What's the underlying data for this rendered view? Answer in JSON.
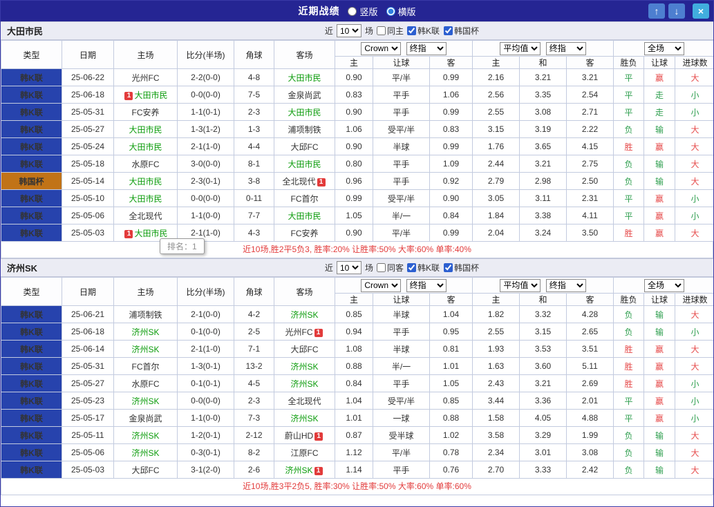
{
  "titlebar": {
    "title": "近期战绩",
    "layout_options": [
      "竖版",
      "横版"
    ],
    "selected_layout": "横版"
  },
  "tooltip": {
    "text": "排名：1"
  },
  "filters_template": {
    "prefix": "近",
    "count": "10",
    "suffix": "场"
  },
  "header_template": {
    "main_cols": [
      "类型",
      "日期",
      "主场",
      "比分(半场)",
      "角球",
      "客场"
    ],
    "odds_group": {
      "bookmaker": "Crown",
      "index": "终指",
      "subcols": [
        "主",
        "让球",
        "客"
      ]
    },
    "europe_group": {
      "average": "平均值",
      "index": "终指",
      "subcols": [
        "主",
        "和",
        "客"
      ]
    },
    "result_group": {
      "scope": "全场",
      "subcols": [
        "胜负",
        "让球",
        "进球数"
      ]
    }
  },
  "league_styles": {
    "韩K联": "k",
    "韩国杯": "cup"
  },
  "value_colors": {
    "胜": "#e64a4a",
    "平": "#2e9e4e",
    "负": "#2e9e4e",
    "赢": "#e64a4a",
    "输": "#2e9e4e",
    "走": "#2e9e4e",
    "大": "#e64a4a",
    "小": "#2e9e4e"
  },
  "colors": {
    "titlebar_bg": "#252593",
    "league_blue": "#2743ad",
    "cup_orange": "#c17317",
    "focal_team_green": "#0a9b0a",
    "score_red": "#c8382b",
    "summary_red": "#e23a3a"
  },
  "sections": [
    {
      "team": "大田市民",
      "filters": {
        "same_side": "同主",
        "same_checked": false,
        "leagues": [
          {
            "label": "韩K联",
            "checked": true
          },
          {
            "label": "韩国杯",
            "checked": true
          }
        ]
      },
      "rows": [
        {
          "league": "韩K联",
          "date": "25-06-22",
          "home": "光州FC",
          "home_focal": false,
          "home_badge": "",
          "score": "2-2(0-0)",
          "corner": "4-8",
          "away": "大田市民",
          "away_focal": true,
          "away_badge": "",
          "asian_home": "0.90",
          "handicap": "平/半",
          "asian_away": "0.99",
          "avg_home": "2.16",
          "avg_draw": "3.21",
          "avg_away": "3.21",
          "result": "平",
          "handicap_result": "赢",
          "goals": "大"
        },
        {
          "league": "韩K联",
          "date": "25-06-18",
          "home": "大田市民",
          "home_focal": true,
          "home_badge": "1",
          "score": "0-0(0-0)",
          "corner": "7-5",
          "away": "金泉尚武",
          "away_focal": false,
          "away_badge": "",
          "asian_home": "0.83",
          "handicap": "平手",
          "asian_away": "1.06",
          "avg_home": "2.56",
          "avg_draw": "3.35",
          "avg_away": "2.54",
          "result": "平",
          "handicap_result": "走",
          "goals": "小"
        },
        {
          "league": "韩K联",
          "date": "25-05-31",
          "home": "FC安养",
          "home_focal": false,
          "home_badge": "",
          "score": "1-1(0-1)",
          "corner": "2-3",
          "away": "大田市民",
          "away_focal": true,
          "away_badge": "",
          "asian_home": "0.90",
          "handicap": "平手",
          "asian_away": "0.99",
          "avg_home": "2.55",
          "avg_draw": "3.08",
          "avg_away": "2.71",
          "result": "平",
          "handicap_result": "走",
          "goals": "小"
        },
        {
          "league": "韩K联",
          "date": "25-05-27",
          "home": "大田市民",
          "home_focal": true,
          "home_badge": "",
          "score": "1-3(1-2)",
          "corner": "1-3",
          "away": "浦项制铁",
          "away_focal": false,
          "away_badge": "",
          "asian_home": "1.06",
          "handicap": "受平/半",
          "asian_away": "0.83",
          "avg_home": "3.15",
          "avg_draw": "3.19",
          "avg_away": "2.22",
          "result": "负",
          "handicap_result": "输",
          "goals": "大"
        },
        {
          "league": "韩K联",
          "date": "25-05-24",
          "home": "大田市民",
          "home_focal": true,
          "home_badge": "",
          "score": "2-1(1-0)",
          "corner": "4-4",
          "away": "大邱FC",
          "away_focal": false,
          "away_badge": "",
          "asian_home": "0.90",
          "handicap": "半球",
          "asian_away": "0.99",
          "avg_home": "1.76",
          "avg_draw": "3.65",
          "avg_away": "4.15",
          "result": "胜",
          "handicap_result": "赢",
          "goals": "大"
        },
        {
          "league": "韩K联",
          "date": "25-05-18",
          "home": "水原FC",
          "home_focal": false,
          "home_badge": "",
          "score": "3-0(0-0)",
          "corner": "8-1",
          "away": "大田市民",
          "away_focal": true,
          "away_badge": "",
          "asian_home": "0.80",
          "handicap": "平手",
          "asian_away": "1.09",
          "avg_home": "2.44",
          "avg_draw": "3.21",
          "avg_away": "2.75",
          "result": "负",
          "handicap_result": "输",
          "goals": "大"
        },
        {
          "league": "韩国杯",
          "date": "25-05-14",
          "home": "大田市民",
          "home_focal": true,
          "home_badge": "",
          "score": "2-3(0-1)",
          "corner": "3-8",
          "away": "全北现代",
          "away_focal": false,
          "away_badge": "1",
          "asian_home": "0.96",
          "handicap": "平手",
          "asian_away": "0.92",
          "avg_home": "2.79",
          "avg_draw": "2.98",
          "avg_away": "2.50",
          "result": "负",
          "handicap_result": "输",
          "goals": "大"
        },
        {
          "league": "韩K联",
          "date": "25-05-10",
          "home": "大田市民",
          "home_focal": true,
          "home_badge": "",
          "score": "0-0(0-0)",
          "corner": "0-11",
          "away": "FC首尔",
          "away_focal": false,
          "away_badge": "",
          "asian_home": "0.99",
          "handicap": "受平/半",
          "asian_away": "0.90",
          "avg_home": "3.05",
          "avg_draw": "3.11",
          "avg_away": "2.31",
          "result": "平",
          "handicap_result": "赢",
          "goals": "小"
        },
        {
          "league": "韩K联",
          "date": "25-05-06",
          "home": "全北现代",
          "home_focal": false,
          "home_badge": "",
          "score": "1-1(0-0)",
          "corner": "7-7",
          "away": "大田市民",
          "away_focal": true,
          "away_badge": "",
          "asian_home": "1.05",
          "handicap": "半/一",
          "asian_away": "0.84",
          "avg_home": "1.84",
          "avg_draw": "3.38",
          "avg_away": "4.11",
          "result": "平",
          "handicap_result": "赢",
          "goals": "小"
        },
        {
          "league": "韩K联",
          "date": "25-05-03",
          "home": "大田市民",
          "home_focal": true,
          "home_badge": "1",
          "score": "2-1(1-0)",
          "corner": "4-3",
          "away": "FC安养",
          "away_focal": false,
          "away_badge": "",
          "asian_home": "0.90",
          "handicap": "平/半",
          "asian_away": "0.99",
          "avg_home": "2.04",
          "avg_draw": "3.24",
          "avg_away": "3.50",
          "result": "胜",
          "handicap_result": "赢",
          "goals": "大"
        }
      ],
      "summary": "近10场,胜2平5负3, 胜率:20% 让胜率:50% 大率:60% 单率:40%"
    },
    {
      "team": "济州SK",
      "filters": {
        "same_side": "同客",
        "same_checked": false,
        "leagues": [
          {
            "label": "韩K联",
            "checked": true
          },
          {
            "label": "韩国杯",
            "checked": true
          }
        ]
      },
      "rows": [
        {
          "league": "韩K联",
          "date": "25-06-21",
          "home": "浦项制铁",
          "home_focal": false,
          "home_badge": "",
          "score": "2-1(0-0)",
          "corner": "4-2",
          "away": "济州SK",
          "away_focal": true,
          "away_badge": "",
          "asian_home": "0.85",
          "handicap": "半球",
          "asian_away": "1.04",
          "avg_home": "1.82",
          "avg_draw": "3.32",
          "avg_away": "4.28",
          "result": "负",
          "handicap_result": "输",
          "goals": "大"
        },
        {
          "league": "韩K联",
          "date": "25-06-18",
          "home": "济州SK",
          "home_focal": true,
          "home_badge": "",
          "score": "0-1(0-0)",
          "corner": "2-5",
          "away": "光州FC",
          "away_focal": false,
          "away_badge": "1",
          "asian_home": "0.94",
          "handicap": "平手",
          "asian_away": "0.95",
          "avg_home": "2.55",
          "avg_draw": "3.15",
          "avg_away": "2.65",
          "result": "负",
          "handicap_result": "输",
          "goals": "小"
        },
        {
          "league": "韩K联",
          "date": "25-06-14",
          "home": "济州SK",
          "home_focal": true,
          "home_badge": "",
          "score": "2-1(1-0)",
          "corner": "7-1",
          "away": "大邱FC",
          "away_focal": false,
          "away_badge": "",
          "asian_home": "1.08",
          "handicap": "半球",
          "asian_away": "0.81",
          "avg_home": "1.93",
          "avg_draw": "3.53",
          "avg_away": "3.51",
          "result": "胜",
          "handicap_result": "赢",
          "goals": "大"
        },
        {
          "league": "韩K联",
          "date": "25-05-31",
          "home": "FC首尔",
          "home_focal": false,
          "home_badge": "",
          "score": "1-3(0-1)",
          "corner": "13-2",
          "away": "济州SK",
          "away_focal": true,
          "away_badge": "",
          "asian_home": "0.88",
          "handicap": "半/一",
          "asian_away": "1.01",
          "avg_home": "1.63",
          "avg_draw": "3.60",
          "avg_away": "5.11",
          "result": "胜",
          "handicap_result": "赢",
          "goals": "大"
        },
        {
          "league": "韩K联",
          "date": "25-05-27",
          "home": "水原FC",
          "home_focal": false,
          "home_badge": "",
          "score": "0-1(0-1)",
          "corner": "4-5",
          "away": "济州SK",
          "away_focal": true,
          "away_badge": "",
          "asian_home": "0.84",
          "handicap": "平手",
          "asian_away": "1.05",
          "avg_home": "2.43",
          "avg_draw": "3.21",
          "avg_away": "2.69",
          "result": "胜",
          "handicap_result": "赢",
          "goals": "小"
        },
        {
          "league": "韩K联",
          "date": "25-05-23",
          "home": "济州SK",
          "home_focal": true,
          "home_badge": "",
          "score": "0-0(0-0)",
          "corner": "2-3",
          "away": "全北现代",
          "away_focal": false,
          "away_badge": "",
          "asian_home": "1.04",
          "handicap": "受平/半",
          "asian_away": "0.85",
          "avg_home": "3.44",
          "avg_draw": "3.36",
          "avg_away": "2.01",
          "result": "平",
          "handicap_result": "赢",
          "goals": "小"
        },
        {
          "league": "韩K联",
          "date": "25-05-17",
          "home": "金泉尚武",
          "home_focal": false,
          "home_badge": "",
          "score": "1-1(0-0)",
          "corner": "7-3",
          "away": "济州SK",
          "away_focal": true,
          "away_badge": "",
          "asian_home": "1.01",
          "handicap": "一球",
          "asian_away": "0.88",
          "avg_home": "1.58",
          "avg_draw": "4.05",
          "avg_away": "4.88",
          "result": "平",
          "handicap_result": "赢",
          "goals": "小"
        },
        {
          "league": "韩K联",
          "date": "25-05-11",
          "home": "济州SK",
          "home_focal": true,
          "home_badge": "",
          "score": "1-2(0-1)",
          "corner": "2-12",
          "away": "蔚山HD",
          "away_focal": false,
          "away_badge": "1",
          "asian_home": "0.87",
          "handicap": "受半球",
          "asian_away": "1.02",
          "avg_home": "3.58",
          "avg_draw": "3.29",
          "avg_away": "1.99",
          "result": "负",
          "handicap_result": "输",
          "goals": "大"
        },
        {
          "league": "韩K联",
          "date": "25-05-06",
          "home": "济州SK",
          "home_focal": true,
          "home_badge": "",
          "score": "0-3(0-1)",
          "corner": "8-2",
          "away": "江原FC",
          "away_focal": false,
          "away_badge": "",
          "asian_home": "1.12",
          "handicap": "平/半",
          "asian_away": "0.78",
          "avg_home": "2.34",
          "avg_draw": "3.01",
          "avg_away": "3.08",
          "result": "负",
          "handicap_result": "输",
          "goals": "大"
        },
        {
          "league": "韩K联",
          "date": "25-05-03",
          "home": "大邱FC",
          "home_focal": false,
          "home_badge": "",
          "score": "3-1(2-0)",
          "corner": "2-6",
          "away": "济州SK",
          "away_focal": true,
          "away_badge": "1",
          "asian_home": "1.14",
          "handicap": "平手",
          "asian_away": "0.76",
          "avg_home": "2.70",
          "avg_draw": "3.33",
          "avg_away": "2.42",
          "result": "负",
          "handicap_result": "输",
          "goals": "大"
        }
      ],
      "summary": "近10场,胜3平2负5, 胜率:30% 让胜率:50% 大率:60% 单率:60%"
    }
  ]
}
